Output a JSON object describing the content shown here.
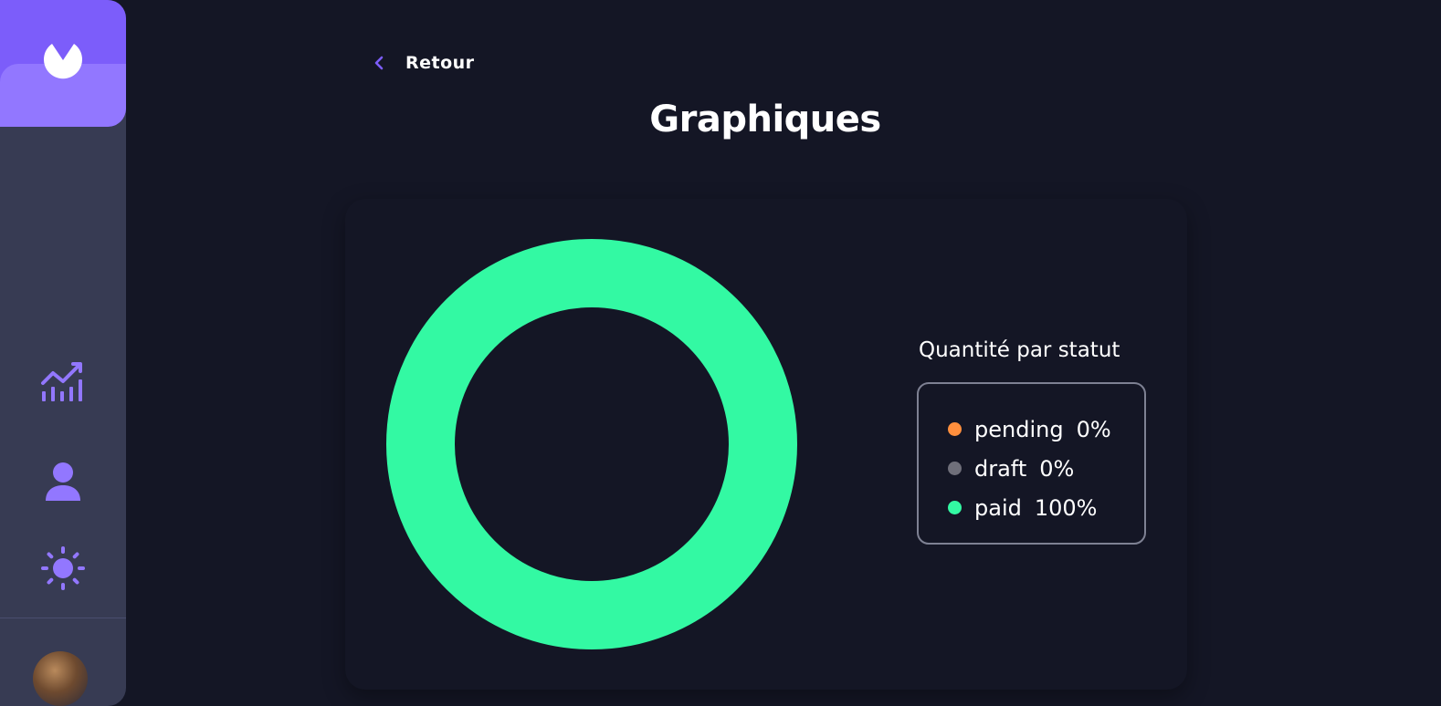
{
  "nav": {
    "back_label": "Retour",
    "icons": [
      "chart-icon",
      "user-icon",
      "sun-icon"
    ]
  },
  "page": {
    "title": "Graphiques"
  },
  "colors": {
    "accent": "#7C5DFA",
    "accent_light": "#9277FF",
    "background": "#141625",
    "sidebar": "#373B53"
  },
  "chart_data": {
    "type": "pie",
    "title": "Quantité par statut",
    "legend_position": "right",
    "categories": [
      "pending",
      "draft",
      "paid"
    ],
    "values": [
      0,
      0,
      100
    ],
    "value_labels": [
      "0%",
      "0%",
      "100%"
    ],
    "colors": [
      "#FF8F3D",
      "#6F6F7A",
      "#33F9A3"
    ]
  }
}
